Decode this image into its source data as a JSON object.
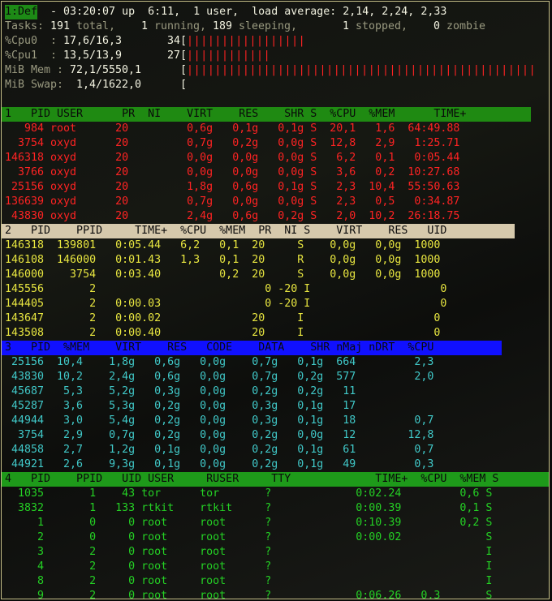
{
  "top": {
    "tab": "1:Def",
    "line1": " - 03:20:07 up  6:11,  1 user,  load average: 2,14, 2,24, 2,33",
    "tasks_label": "Tasks:",
    "tasks_total": " 191",
    "tasks_total_lbl": " total,",
    "tasks_running": "   1",
    "tasks_running_lbl": " running,",
    "tasks_sleeping": " 189",
    "tasks_sleeping_lbl": " sleeping,",
    "tasks_stopped": "   1",
    "tasks_stopped_lbl": " stopped,",
    "tasks_zombie": "   0",
    "tasks_zombie_lbl": " zombie",
    "cpu0_label": "%Cpu0  :",
    "cpu0_vals": " 17,6/16,3",
    "cpu0_pct": "34[",
    "cpu0_bar": "|||||||||||||||||",
    "cpu1_label": "%Cpu1  :",
    "cpu1_vals": " 13,5/13,9",
    "cpu1_pct": "27[",
    "cpu1_bar": "||||||||||||",
    "mem_label": "MiB Mem :",
    "mem_vals": " 72,1/5550,1",
    "mem_pct": "[",
    "mem_bar": "||||||||||||||||||||||||||||||||||||||||||||||||||",
    "swap_label": "MiB Swap:",
    "swap_vals": "  1,4/1622,0",
    "swap_pct": "[",
    "swap_bar": ""
  },
  "win1": {
    "header": "1   PID USER      PR  NI    VIRT    RES    SHR S  %CPU  %MEM      TIME+",
    "rows": [
      "   984 root      20         0,6g   0,1g   0,1g S  20,1   1,6  64:49.88",
      "  3754 oxyd      20         0,7g   0,2g   0,0g S  12,8   2,9   1:25.71",
      "146318 oxyd      20         0,0g   0,0g   0,0g S   6,2   0,1   0:05.44",
      "  3766 oxyd      20         0,0g   0,0g   0,0g S   3,6   0,2  10:27.68",
      " 25156 oxyd      20         1,8g   0,6g   0,1g S   2,3  10,4  55:50.63",
      "136639 oxyd      20         0,7g   0,0g   0,0g S   2,3   0,5   0:34.87",
      " 43830 oxyd      20         2,4g   0,6g   0,2g S   2,0  10,2  26:18.75"
    ]
  },
  "win2": {
    "header": "2   PID    PPID     TIME+  %CPU  %MEM  PR  NI S    VIRT    RES   UID",
    "rows": [
      "146318  139801   0:05.44   6,2   0,1  20     S    0,0g   0,0g  1000",
      "146108  146000   0:01.43   1,3   0,1  20     R    0,0g   0,0g  1000",
      "146000    3754   0:03.40         0,2  20     S    0,0g   0,0g  1000",
      "145556       2                          0 -20 I                    0",
      "144405       2   0:00.03                0 -20 I                    0",
      "143647       2   0:00.02              20     I                    0",
      "143508       2   0:00.40              20     I                    0"
    ]
  },
  "win3": {
    "header": "3   PID  %MEM    VIRT    RES   CODE    DATA    SHR nMaj nDRT  %CPU",
    "rows": [
      " 25156  10,4    1,8g   0,6g   0,0g    0,7g   0,1g  664         2,3",
      " 43830  10,2    2,4g   0,6g   0,0g    0,7g   0,2g  577         2,0",
      " 45687   5,3    5,2g   0,3g   0,0g    0,2g   0,2g   11",
      " 45287   3,6    5,3g   0,2g   0,0g    0,3g   0,1g   17",
      " 44944   3,0    5,4g   0,2g   0,0g    0,3g   0,1g   18         0,7",
      "  3754   2,9    0,7g   0,2g   0,0g    0,2g   0,0g   12        12,8",
      " 44858   2,7    1,2g   0,1g   0,0g    0,2g   0,1g   61         0,7",
      " 44921   2,6    9,3g   0,1g   0,0g    0,2g   0,1g   49         0,3"
    ]
  },
  "win4": {
    "header": "4   PID    PPID   UID USER     RUSER     TTY             TIME+  %CPU  %MEM S",
    "rows": [
      "  1035       1    43 tor      tor       ?             0:02.24         0,6 S",
      "  3832       1   133 rtkit    rtkit     ?             0:00.39         0,1 S",
      "     1       0     0 root     root      ?             0:10.39         0,2 S",
      "     2       0     0 root     root      ?             0:00.02             S",
      "     3       2     0 root     root      ?                                 I",
      "     4       2     0 root     root      ?                                 I",
      "     8       2     0 root     root      ?                                 I",
      "     9       2     0 root     root      ?             0:06.26   0,3       S"
    ]
  },
  "colors": {
    "win1_fg": "#ff2323",
    "win2_fg": "#e8e640",
    "win3_fg": "#40c8c8",
    "win4_fg": "#24d024"
  }
}
